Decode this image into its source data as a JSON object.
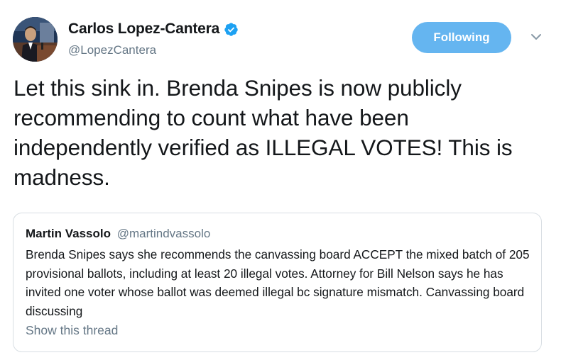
{
  "author": {
    "name": "Carlos Lopez-Cantera",
    "handle": "@LopezCantera",
    "verified": true,
    "avatar_icon": "profile-photo"
  },
  "follow_button": {
    "label": "Following",
    "color": "#65b5f0"
  },
  "menu_icon": "chevron-down-icon",
  "tweet": {
    "text": "Let this sink in. Brenda Snipes is now publicly recommending to count what have been independently verified as ILLEGAL VOTES! This is madness."
  },
  "quoted_tweet": {
    "name": "Martin Vassolo",
    "handle": "@martindvassolo",
    "text": "Brenda Snipes says she recommends the canvassing board ACCEPT the mixed batch of 205 provisional ballots, including at least 20 illegal votes. Attorney for Bill Nelson says he has invited one voter whose ballot was deemed illegal bc signature mismatch. Canvassing board discussing",
    "show_thread_label": "Show this thread"
  },
  "colors": {
    "accent": "#1da1f2",
    "muted_text": "#657786",
    "text": "#14171a",
    "border": "#d8dee3"
  }
}
